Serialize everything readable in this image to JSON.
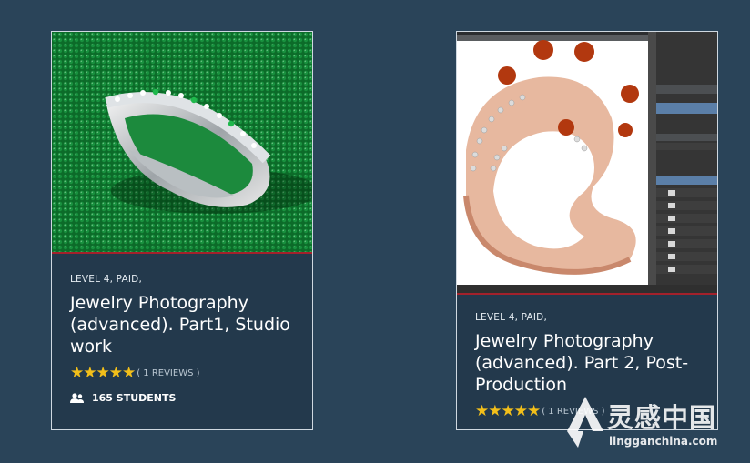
{
  "cards": [
    {
      "level": "LEVEL 4, PAID,",
      "title": "Jewelry Photography (advanced). Part1, Studio work",
      "stars": "★★★★★",
      "reviews": "( 1 REVIEWS )",
      "students": "165 STUDENTS"
    },
    {
      "level": "LEVEL 4, PAID,",
      "title": "Jewelry Photography (advanced). Part 2, Post-Production",
      "stars": "★★★★★",
      "reviews": "( 1 REVIEWS )",
      "rating_value": 5,
      "rating_max": 5
    }
  ],
  "watermark": {
    "cn": "灵感中国",
    "en": "lingganchina.com"
  },
  "colors": {
    "background": "#2a4459",
    "card": "#23394c",
    "star": "#f2bf1a",
    "accent_line": "#a3212b"
  }
}
